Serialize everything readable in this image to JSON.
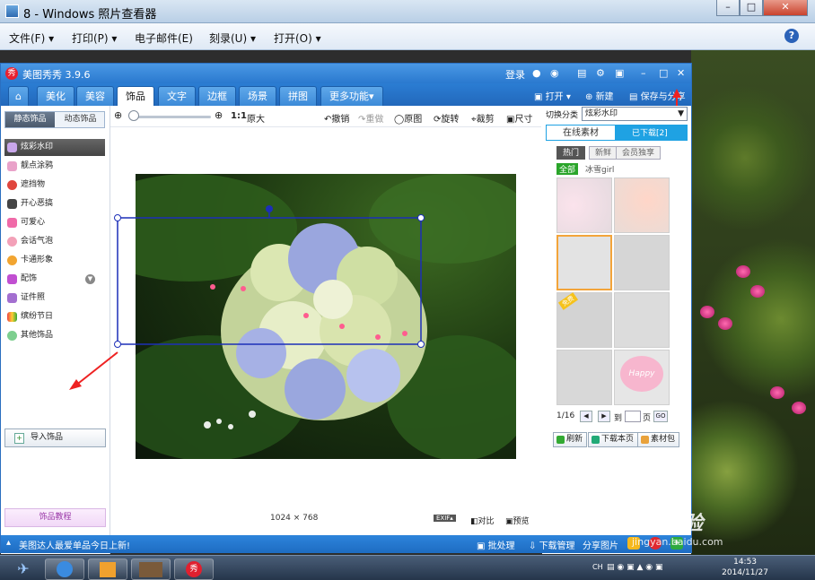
{
  "viewer": {
    "title": "8 - Windows 照片查看器",
    "menus": [
      "文件(F) ▾",
      "打印(P) ▾",
      "电子邮件(E)",
      "刻录(U) ▾",
      "打开(O) ▾"
    ],
    "help": "?"
  },
  "app": {
    "title": "美图秀秀 3.9.6",
    "logo": "秀",
    "login": "登录",
    "tabs": [
      "美化",
      "美容",
      "饰品",
      "文字",
      "边框",
      "场景",
      "拼图",
      "更多功能▾"
    ],
    "active_tab": "饰品",
    "actions": {
      "open": "打开",
      "new": "新建",
      "save": "保存与分享"
    },
    "toolbar": {
      "ratio": "1:1",
      "original_size": "原大",
      "undo": "撤销",
      "redo": "重做",
      "original": "原图",
      "rotate": "旋转",
      "crop": "裁剪",
      "size": "尺寸"
    },
    "left": {
      "subtabs": [
        "静态饰品",
        "动态饰品"
      ],
      "categories": [
        "炫彩水印",
        "靓点涂鸦",
        "遮挡物",
        "开心恶搞",
        "可爱心",
        "会话气泡",
        "卡通形象",
        "配饰",
        "证件照",
        "缤纷节日",
        "其他饰品"
      ],
      "import": "导入饰品",
      "tutorial": "饰品教程"
    },
    "canvas": {
      "dimensions": "1024 × 768",
      "exif": "EXIF▴",
      "compare": "对比",
      "preview": "预览"
    },
    "right": {
      "category_label": "切换分类",
      "category_value": "炫彩水印",
      "tab_online": "在线素材",
      "tab_downloaded": "已下载[2]",
      "filters": [
        "热门",
        "新鲜",
        "会员独享"
      ],
      "tag_all": "全部",
      "tag_name": "冰雪girl",
      "badge_free": "免费",
      "happy": "Happy",
      "page": "1/16",
      "to": "到",
      "page_unit": "页",
      "go": "GO",
      "refresh": "刷新",
      "download_page": "下载本页",
      "material_pack": "素材包"
    },
    "status": {
      "message": "美图达人最爱单品今日上新!",
      "batch": "批处理",
      "download_mgr": "下载管理",
      "share_pic": "分享图片"
    }
  },
  "taskbar": {
    "lang": "CH",
    "time": "14:53",
    "date": "2014/11/27"
  },
  "watermark": {
    "brand": "Bai经验",
    "url": "jingyan.baidu.com"
  }
}
